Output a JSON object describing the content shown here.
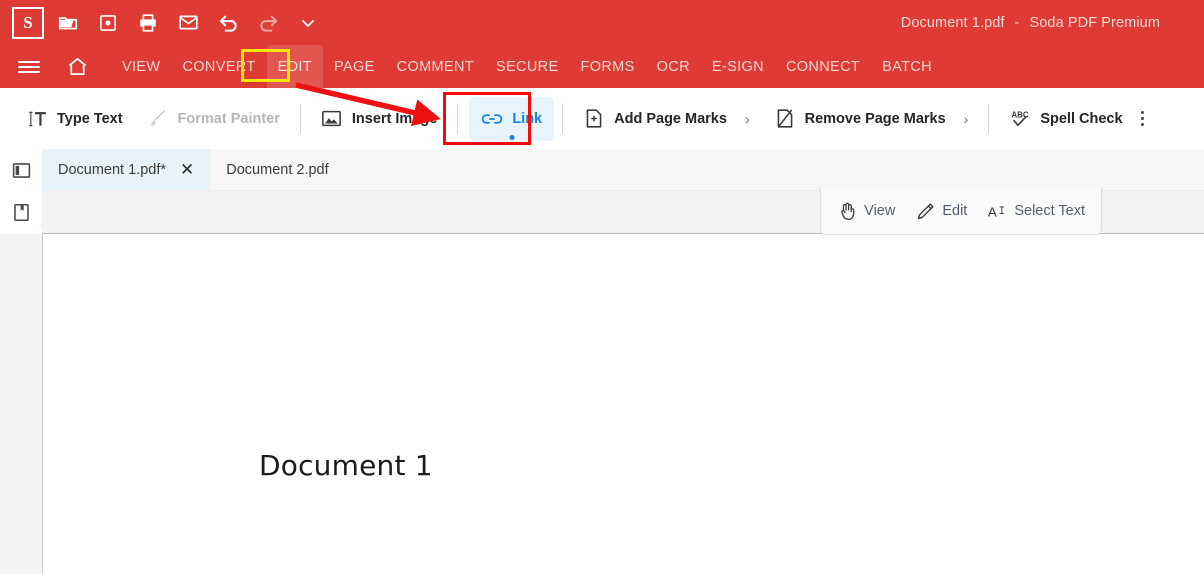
{
  "titlebar": {
    "logo_letter": "S",
    "document_name": "Document 1.pdf",
    "separator": "-",
    "app_name": "Soda PDF Premium",
    "quick_actions": [
      {
        "name": "open-file-icon",
        "label": "Open"
      },
      {
        "name": "save-icon",
        "label": "Save"
      },
      {
        "name": "print-icon",
        "label": "Print"
      },
      {
        "name": "email-icon",
        "label": "Email"
      },
      {
        "name": "undo-icon",
        "label": "Undo"
      },
      {
        "name": "redo-icon",
        "label": "Redo"
      },
      {
        "name": "chevron-down-icon",
        "label": "More"
      }
    ],
    "brand_color": "#dd3b33"
  },
  "menubar": {
    "items": [
      {
        "label": "VIEW",
        "active": false
      },
      {
        "label": "CONVERT",
        "active": false
      },
      {
        "label": "EDIT",
        "active": true
      },
      {
        "label": "PAGE",
        "active": false
      },
      {
        "label": "COMMENT",
        "active": false
      },
      {
        "label": "SECURE",
        "active": false
      },
      {
        "label": "FORMS",
        "active": false
      },
      {
        "label": "OCR",
        "active": false
      },
      {
        "label": "E-SIGN",
        "active": false
      },
      {
        "label": "CONNECT",
        "active": false
      },
      {
        "label": "BATCH",
        "active": false
      }
    ]
  },
  "ribbon": {
    "type_text": "Type Text",
    "format_painter": "Format Painter",
    "insert_image": "Insert Image",
    "link": "Link",
    "add_page_marks": "Add Page Marks",
    "remove_page_marks": "Remove Page Marks",
    "spell_check": "Spell Check",
    "chevron": "›",
    "active_accent": "#1a80e0",
    "active_bg": "#e8f4fd"
  },
  "tabs": {
    "items": [
      {
        "label": "Document 1.pdf*",
        "active": true,
        "close": "✕"
      },
      {
        "label": "Document 2.pdf",
        "active": false
      }
    ]
  },
  "sidebar": {
    "items": [
      {
        "name": "panel-toggle-icon",
        "label": "Toggle Panel"
      },
      {
        "name": "bookmark-icon",
        "label": "Bookmarks"
      }
    ]
  },
  "modebar": {
    "items": [
      {
        "label": "View",
        "icon": "hand-icon",
        "selected": false
      },
      {
        "label": "Edit",
        "icon": "pencil-icon",
        "selected": true
      },
      {
        "label": "Select Text",
        "icon": "select-text-icon",
        "selected": false
      }
    ]
  },
  "document": {
    "heading": "Document 1"
  },
  "annotations": {
    "highlight_box_color": "#ffe600",
    "focus_box_color": "#f50b0b",
    "arrow_color": "#ee1111",
    "arrow_from": "EDIT",
    "arrow_to": "Link"
  }
}
